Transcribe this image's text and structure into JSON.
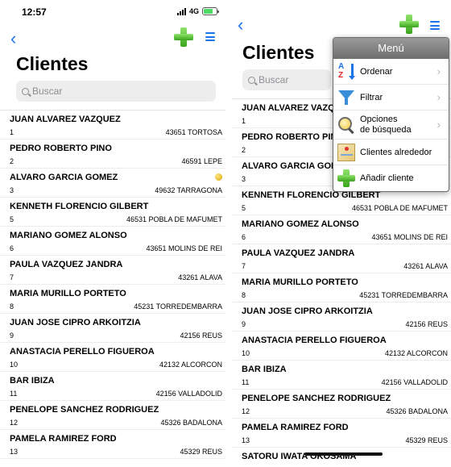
{
  "left": {
    "status": {
      "time": "12:57",
      "network": "4G"
    },
    "title": "Clientes",
    "search_placeholder": "Buscar",
    "clients": [
      {
        "name": "JUAN ALVAREZ VAZQUEZ",
        "num": "1",
        "addr": "43651 TORTOSA"
      },
      {
        "name": "PEDRO ROBERTO PINO",
        "num": "2",
        "addr": "46591 LEPE"
      },
      {
        "name": "ALVARO GARCIA GOMEZ",
        "num": "3",
        "addr": "49632 TARRAGONA"
      },
      {
        "name": "KENNETH FLORENCIO GILBERT",
        "num": "5",
        "addr": "46531 POBLA DE MAFUMET"
      },
      {
        "name": "MARIANO GOMEZ ALONSO",
        "num": "6",
        "addr": "43651 MOLINS DE REI"
      },
      {
        "name": "PAULA VAZQUEZ JANDRA",
        "num": "7",
        "addr": "43261 ALAVA"
      },
      {
        "name": "MARIA MURILLO PORTETO",
        "num": "8",
        "addr": "45231 TORREDEMBARRA"
      },
      {
        "name": "JUAN JOSE CIPRO ARKOITZIA",
        "num": "9",
        "addr": "42156 REUS"
      },
      {
        "name": "ANASTACIA PERELLO FIGUEROA",
        "num": "10",
        "addr": "42132 ALCORCON"
      },
      {
        "name": "BAR IBIZA",
        "num": "11",
        "addr": "42156 VALLADOLID"
      },
      {
        "name": "PENELOPE SANCHEZ RODRIGUEZ",
        "num": "12",
        "addr": "45326 BADALONA"
      },
      {
        "name": "PAMELA RAMIREZ FORD",
        "num": "13",
        "addr": "45329 REUS"
      }
    ]
  },
  "right": {
    "title": "Clientes",
    "search_placeholder": "Buscar",
    "clients": [
      {
        "name": "JUAN ALVAREZ VAZQ",
        "num": "1",
        "addr": ""
      },
      {
        "name": "PEDRO ROBERTO PIN",
        "num": "2",
        "addr": ""
      },
      {
        "name": "ALVARO GARCIA GOM",
        "num": "3",
        "addr": ""
      },
      {
        "name": "KENNETH FLORENCIO GILBERT",
        "num": "5",
        "addr": "46531 POBLA DE MAFUMET"
      },
      {
        "name": "MARIANO GOMEZ ALONSO",
        "num": "6",
        "addr": "43651 MOLINS DE REI"
      },
      {
        "name": "PAULA VAZQUEZ JANDRA",
        "num": "7",
        "addr": "43261 ALAVA"
      },
      {
        "name": "MARIA MURILLO PORTETO",
        "num": "8",
        "addr": "45231 TORREDEMBARRA"
      },
      {
        "name": "JUAN JOSE CIPRO ARKOITZIA",
        "num": "9",
        "addr": "42156 REUS"
      },
      {
        "name": "ANASTACIA PERELLO FIGUEROA",
        "num": "10",
        "addr": "42132 ALCORCON"
      },
      {
        "name": "BAR IBIZA",
        "num": "11",
        "addr": "42156 VALLADOLID"
      },
      {
        "name": "PENELOPE SANCHEZ RODRIGUEZ",
        "num": "12",
        "addr": "45326 BADALONA"
      },
      {
        "name": "PAMELA RAMIREZ FORD",
        "num": "13",
        "addr": "45329 REUS"
      },
      {
        "name": "SATORU IWATA OKOSAMA",
        "num": "",
        "addr": ""
      }
    ]
  },
  "menu": {
    "title": "Menú",
    "items": [
      {
        "label": "Ordenar",
        "icon": "sort-az-icon",
        "chevron": true
      },
      {
        "label": "Filtrar",
        "icon": "funnel-icon",
        "chevron": true
      },
      {
        "label": "Opciones\nde búsqueda",
        "icon": "magnifier-icon",
        "chevron": true
      },
      {
        "label": "Clientes alrededor",
        "icon": "map-icon",
        "chevron": false
      },
      {
        "label": "Añadir cliente",
        "icon": "plus-icon",
        "chevron": false
      }
    ]
  },
  "icons": {
    "back": "chevron-left-icon",
    "add": "plus-icon",
    "menu": "hamburger-icon",
    "battery": "battery-icon",
    "signal": "signal-icon",
    "search": "search-icon",
    "badge": "yellow-badge-icon"
  },
  "colors": {
    "accent": "#1a73e8",
    "add_green": "#3aa51c",
    "menu_header": "#7d7d7d"
  }
}
